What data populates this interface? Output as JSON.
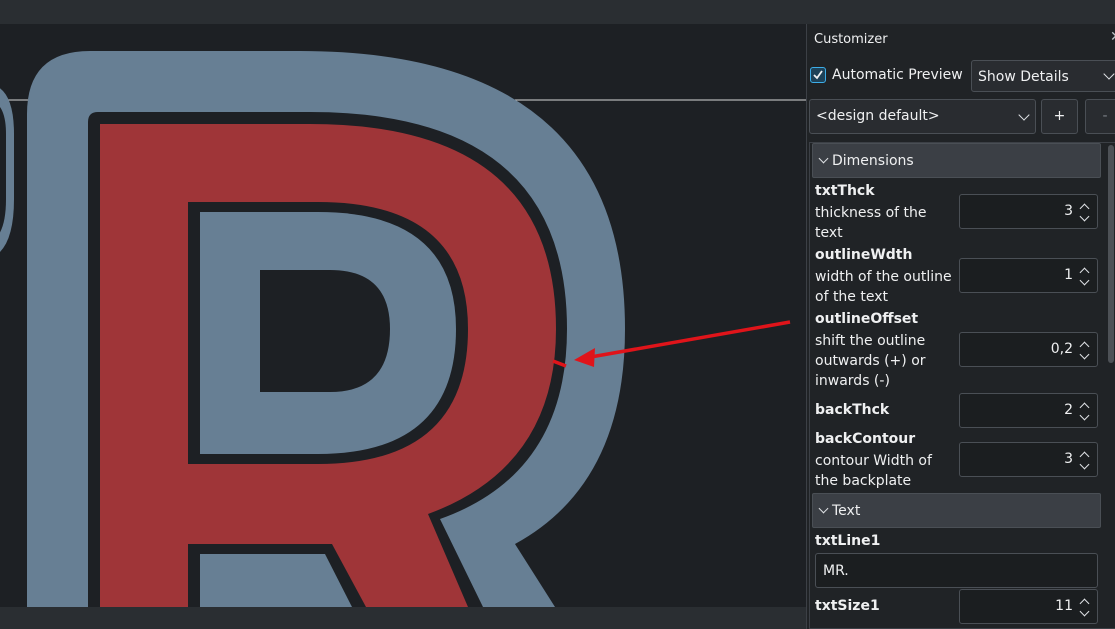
{
  "customizer": {
    "title": "Customizer",
    "close_icon": "close-icon",
    "automatic_preview_label": "Automatic Preview",
    "automatic_preview_checked": true,
    "details_combo_value": "Show Details",
    "preset_combo_value": "<design default>",
    "add_preset_label": "+",
    "remove_preset_label": "-",
    "groups": [
      {
        "label": "Dimensions",
        "params": [
          {
            "name": "txtThck",
            "desc": "thickness of the text",
            "value": "3"
          },
          {
            "name": "outlineWdth",
            "desc": "width of the outline of the text",
            "value": "1"
          },
          {
            "name": "outlineOffset",
            "desc": "shift the outline outwards (+) or inwards (-)",
            "value": "0,2"
          },
          {
            "name": "backThck",
            "desc": "",
            "value": "2"
          },
          {
            "name": "backContour",
            "desc": "contour Width of the backplate",
            "value": "3"
          }
        ]
      },
      {
        "label": "Text",
        "params": [
          {
            "name": "txtLine1",
            "desc": "",
            "value": "MR."
          },
          {
            "name": "txtSize1",
            "desc": "",
            "value": "11"
          }
        ]
      }
    ]
  },
  "colors": {
    "viewport_bg": "#1d2024",
    "letter_fill": "#9f3538",
    "backplate_fill": "#677f94",
    "outline_stroke": "#1d2024",
    "annotation_arrow": "#e0141a",
    "accent": "#3daee9"
  }
}
